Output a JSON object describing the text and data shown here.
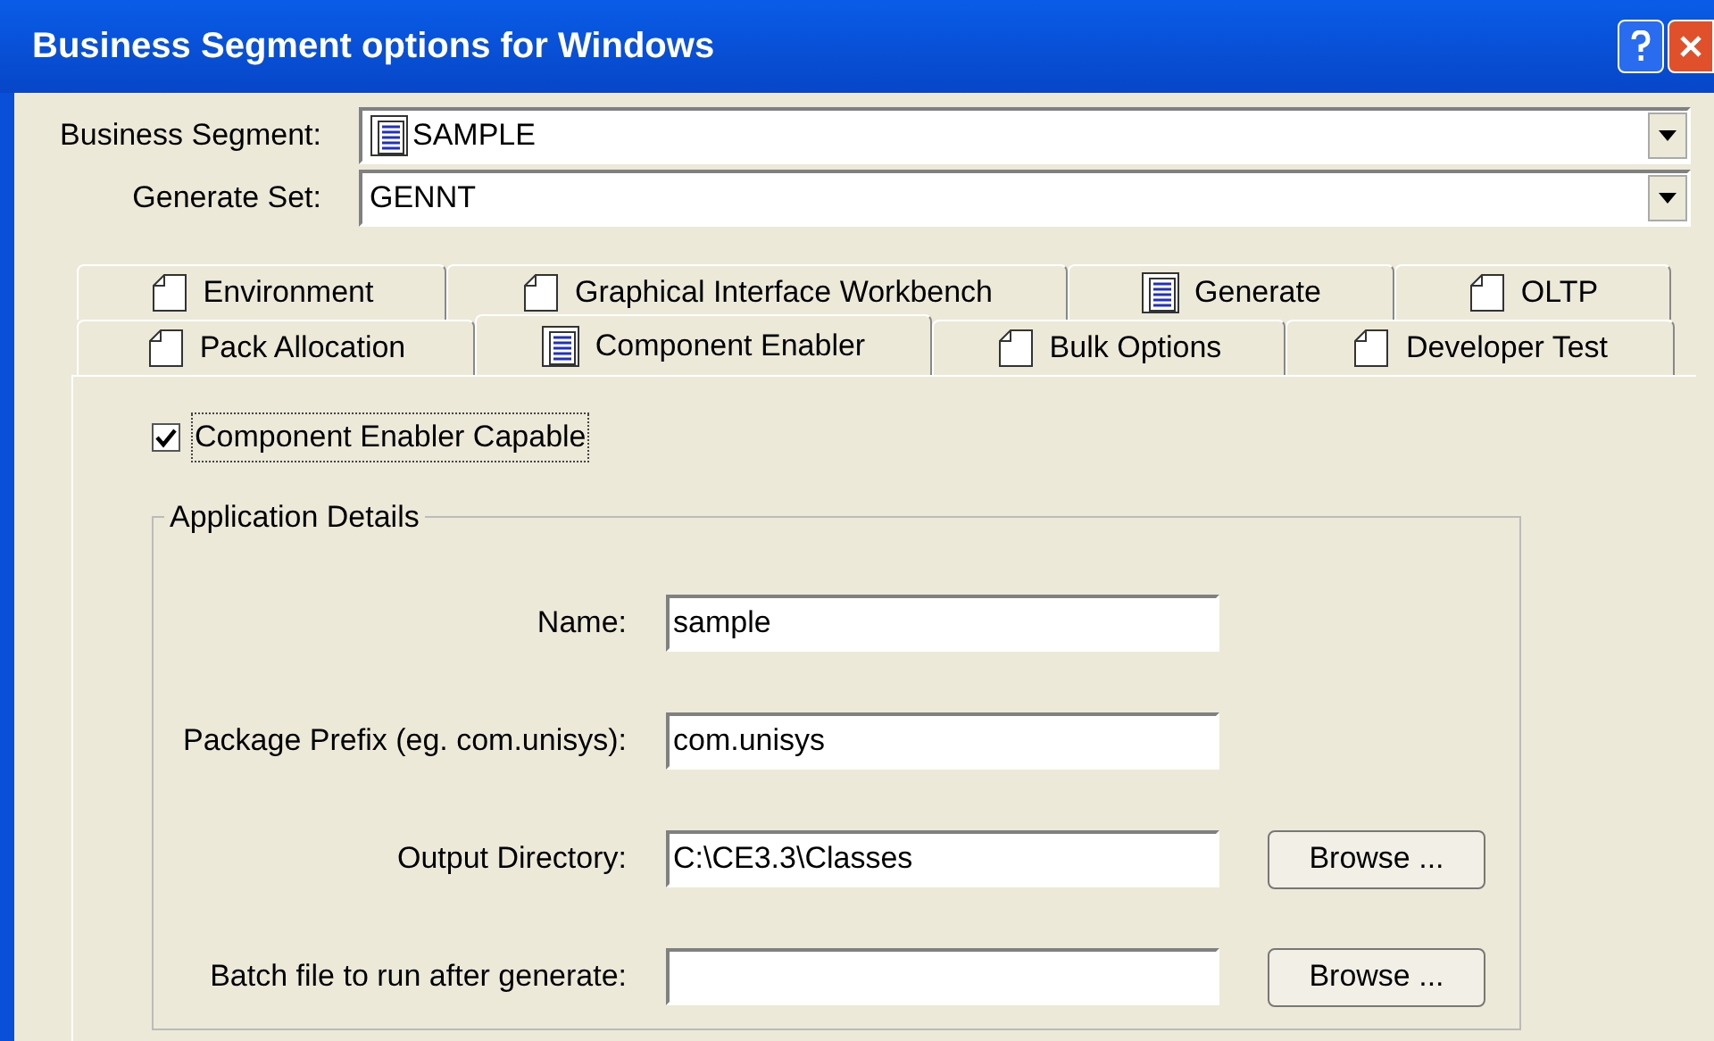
{
  "window": {
    "title": "Business Segment options for Windows"
  },
  "combos": [
    {
      "label": "Business Segment:",
      "value": "SAMPLE",
      "kind": "lined"
    },
    {
      "label": "Generate Set:",
      "value": "GENNT",
      "kind": "none"
    }
  ],
  "tab_rows": [
    [
      {
        "label": "Environment",
        "kind": "blank",
        "selected": false
      },
      {
        "label": "Graphical Interface Workbench",
        "kind": "blank",
        "selected": false
      },
      {
        "label": "Generate",
        "kind": "lined",
        "selected": false
      },
      {
        "label": "OLTP",
        "kind": "blank",
        "selected": false
      }
    ],
    [
      {
        "label": "Pack Allocation",
        "kind": "blank",
        "selected": false
      },
      {
        "label": "Component Enabler",
        "kind": "lined",
        "selected": true
      },
      {
        "label": "Bulk Options",
        "kind": "blank",
        "selected": false
      },
      {
        "label": "Developer Test",
        "kind": "blank",
        "selected": false
      }
    ]
  ],
  "capable": {
    "label": "Component Enabler Capable",
    "checked": true
  },
  "group": {
    "title": "Application Details",
    "fields": [
      {
        "label": "Name:",
        "value": "sample"
      },
      {
        "label": "Package Prefix (eg. com.unisys):",
        "value": "com.unisys"
      },
      {
        "label": "Output Directory:",
        "value": "C:\\CE3.3\\Classes",
        "button": "Browse ..."
      },
      {
        "label": "Batch file to run after generate:",
        "button": "Browse ..."
      }
    ]
  }
}
